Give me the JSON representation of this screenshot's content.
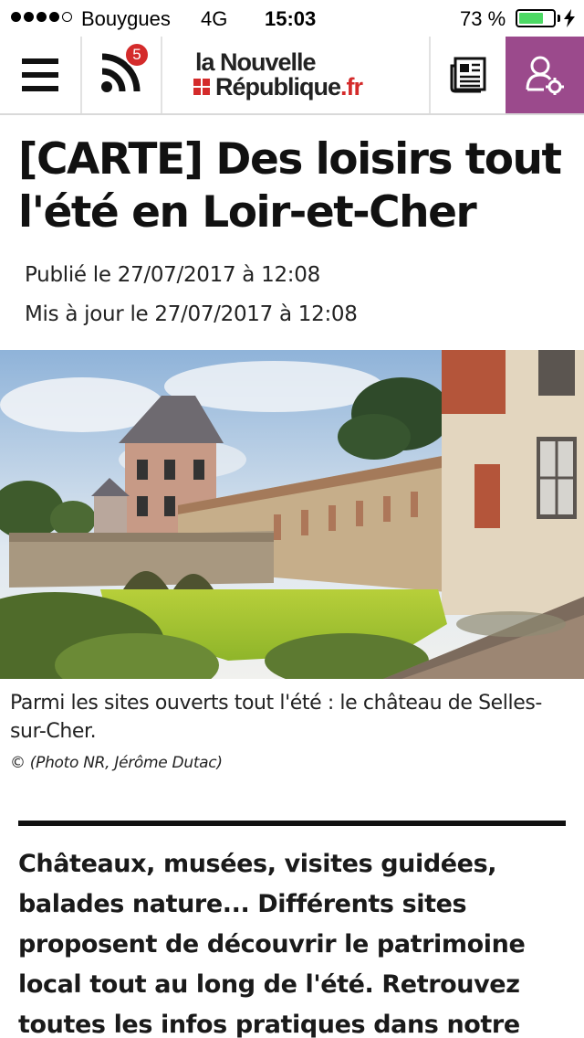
{
  "status_bar": {
    "carrier": "Bouygues",
    "network": "4G",
    "time": "15:03",
    "battery_percent": "73 %",
    "battery_level": 0.73,
    "signal_bars": 4,
    "signal_max": 5
  },
  "header": {
    "menu_icon": "hamburger-menu-icon",
    "rss_icon": "rss-feed-icon",
    "rss_badge": "5",
    "logo": {
      "line1": "la Nouvelle",
      "line2": "République",
      "tld": ".fr"
    },
    "newspaper_icon": "newspaper-icon",
    "account_icon": "user-settings-icon",
    "colors": {
      "accent": "#9b4a8c",
      "badge": "#d42b2b",
      "brand_red": "#d42b2b"
    }
  },
  "article": {
    "title": "[CARTE] Des loisirs tout l'été en Loir-et-Cher",
    "published": "Publié le 27/07/2017 à 12:08",
    "updated": "Mis à jour le 27/07/2017 à 12:08",
    "image_caption": "Parmi les sites ouverts tout l'été : le château de Selles-sur-Cher.",
    "image_credit": "© (Photo NR, Jérôme Dutac)",
    "lead": "Châteaux, musées, visites guidées, balades nature... Différents sites proposent de découvrir le patrimoine local tout au long de l'été. Retrouvez toutes les infos pratiques dans notre"
  }
}
